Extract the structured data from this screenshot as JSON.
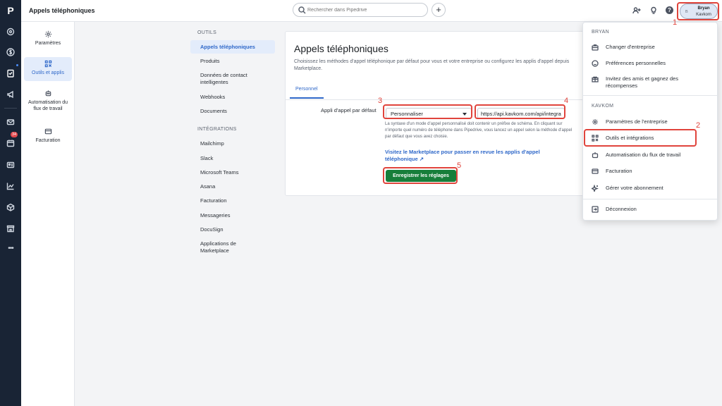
{
  "header": {
    "title": "Appels téléphoniques",
    "search_placeholder": "Rechercher dans Pipedrive",
    "user_name": "Bryan",
    "user_company": "Kavkom",
    "avatar_initials": "B"
  },
  "rail": {
    "logo": "P",
    "badge": "34",
    "more": "•••"
  },
  "sidebar": {
    "items": [
      {
        "label": "Paramètres",
        "icon": "gear-icon"
      },
      {
        "label": "Outils et applis",
        "icon": "tools-icon"
      },
      {
        "label": "Automatisation du flux de travail",
        "icon": "robot-icon"
      },
      {
        "label": "Facturation",
        "icon": "card-icon"
      }
    ]
  },
  "subnav": {
    "tools_heading": "OUTILS",
    "tools": [
      "Appels téléphoniques",
      "Produits",
      "Données de contact intelligentes",
      "Webhooks",
      "Documents"
    ],
    "integrations_heading": "INTÉGRATIONS",
    "integrations": [
      "Mailchimp",
      "Slack",
      "Microsoft Teams",
      "Asana",
      "Facturation",
      "Messageries",
      "DocuSign",
      "Applications de Marketplace"
    ]
  },
  "main": {
    "title": "Appels téléphoniques",
    "description": "Choisissez les méthodes d'appel téléphonique par défaut pour vous et votre entreprise ou configurez les applis d'appel depuis Marketplace.",
    "tab": "Personnel",
    "field_label": "Appli d'appel par défaut",
    "select_value": "Personnaliser",
    "url_value": "https://api.kavkom.com/api/integrations",
    "help_text": "La syntaxe d'un mode d'appel personnalisé doit contenir un préfixe de schéma. En cliquant sur n'importe quel numéro de téléphone dans Pipedrive, vous lancez un appel selon la méthode d'appel par défaut que vous avez choisie.",
    "marketplace_link": "Visitez le Marketplace pour passer en revue les applis d'appel téléphonique ↗",
    "save_label": "Enregistrer les réglages"
  },
  "menu": {
    "section1": "BRYAN",
    "section1_items": [
      "Changer d'entreprise",
      "Préférences personnelles",
      "Invitez des amis et gagnez des récompenses"
    ],
    "section2": "KAVKOM",
    "section2_items": [
      "Paramètres de l'entreprise",
      "Outils et intégrations",
      "Automatisation du flux de travail",
      "Facturation",
      "Gérer votre abonnement"
    ],
    "logout": "Déconnexion"
  },
  "annotations": [
    "1",
    "2",
    "3",
    "4",
    "5"
  ],
  "colors": {
    "accent": "#2f68c9",
    "save": "#177e3a",
    "rail": "#192435",
    "annotation": "#e0443c"
  }
}
